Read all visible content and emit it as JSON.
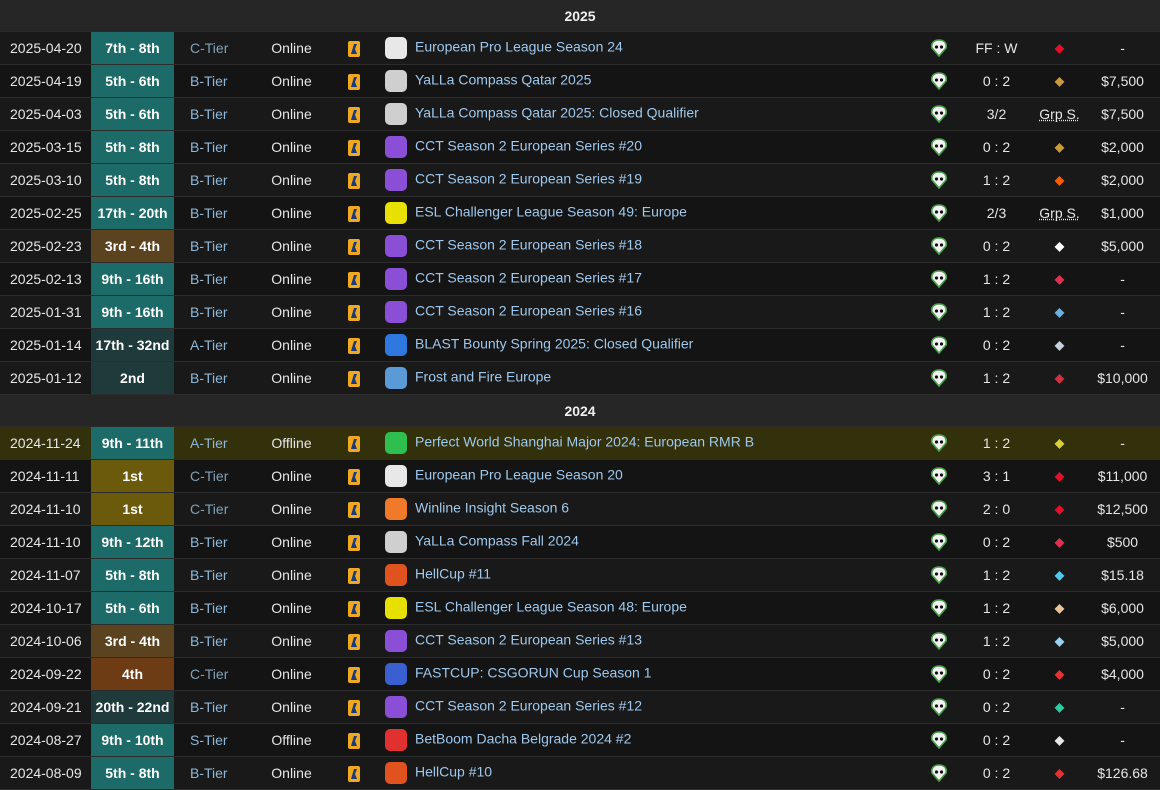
{
  "years": [
    {
      "label": "2025",
      "rows": [
        {
          "date": "2025-04-20",
          "place": "7th - 8th",
          "place_style": "teal",
          "tier": "C-Tier",
          "mode": "Online",
          "tournament": "European Pro League Season 24",
          "tournament_icon": "epl-logo-icon",
          "score": "FF : W",
          "opponent_icon": "dynamo-logo-icon",
          "prize": "-"
        },
        {
          "date": "2025-04-19",
          "place": "5th - 6th",
          "place_style": "teal",
          "tier": "B-Tier",
          "mode": "Online",
          "tournament": "YaLLa Compass Qatar 2025",
          "tournament_icon": "yalla-compass-logo-icon",
          "score": "0 : 2",
          "opponent_icon": "ence-logo-icon",
          "prize": "$7,500"
        },
        {
          "date": "2025-04-03",
          "place": "5th - 6th",
          "place_style": "teal",
          "tier": "B-Tier",
          "mode": "Online",
          "tournament": "YaLLa Compass Qatar 2025: Closed Qualifier",
          "tournament_icon": "yalla-compass-logo-icon",
          "score": "3/2",
          "opponent_text": "Grp S.",
          "prize": "$7,500"
        },
        {
          "date": "2025-03-15",
          "place": "5th - 8th",
          "place_style": "teal",
          "tier": "B-Tier",
          "mode": "Online",
          "tournament": "CCT Season 2 European Series #20",
          "tournament_icon": "cct-logo-icon",
          "score": "0 : 2",
          "opponent_icon": "ence-logo-icon",
          "prize": "$2,000"
        },
        {
          "date": "2025-03-10",
          "place": "5th - 8th",
          "place_style": "teal",
          "tier": "B-Tier",
          "mode": "Online",
          "tournament": "CCT Season 2 European Series #19",
          "tournament_icon": "cct-logo-icon",
          "score": "1 : 2",
          "opponent_icon": "fnatic-logo-icon",
          "prize": "$2,000"
        },
        {
          "date": "2025-02-25",
          "place": "17th - 20th",
          "place_style": "teal",
          "tier": "B-Tier",
          "mode": "Online",
          "tournament": "ESL Challenger League Season 49: Europe",
          "tournament_icon": "ecl-logo-icon",
          "score": "2/3",
          "opponent_text": "Grp S.",
          "prize": "$1,000"
        },
        {
          "date": "2025-02-23",
          "place": "3rd - 4th",
          "place_style": "bronze",
          "tier": "B-Tier",
          "mode": "Online",
          "tournament": "CCT Season 2 European Series #18",
          "tournament_icon": "cct-logo-icon",
          "score": "0 : 2",
          "opponent_icon": "betboom-logo-icon",
          "prize": "$5,000"
        },
        {
          "date": "2025-02-13",
          "place": "9th - 16th",
          "place_style": "teal",
          "tier": "B-Tier",
          "mode": "Online",
          "tournament": "CCT Season 2 European Series #17",
          "tournament_icon": "cct-logo-icon",
          "score": "1 : 2",
          "opponent_icon": "500-logo-icon",
          "prize": "-"
        },
        {
          "date": "2025-01-31",
          "place": "9th - 16th",
          "place_style": "teal",
          "tier": "B-Tier",
          "mode": "Online",
          "tournament": "CCT Season 2 European Series #16",
          "tournament_icon": "cct-logo-icon",
          "score": "1 : 2",
          "opponent_icon": "trident-logo-icon",
          "prize": "-"
        },
        {
          "date": "2025-01-14",
          "place": "17th - 32nd",
          "place_style": "dark",
          "tier": "A-Tier",
          "mode": "Online",
          "tournament": "BLAST Bounty Spring 2025: Closed Qualifier",
          "tournament_icon": "blast-logo-icon",
          "score": "0 : 2",
          "opponent_icon": "liquid-logo-icon",
          "prize": "-"
        },
        {
          "date": "2025-01-12",
          "place": "2nd",
          "place_style": "dark",
          "tier": "B-Tier",
          "mode": "Online",
          "tournament": "Frost and Fire Europe",
          "tournament_icon": "frost-fire-logo-icon",
          "score": "1 : 2",
          "opponent_icon": "red-wings-logo-icon",
          "prize": "$10,000"
        }
      ]
    },
    {
      "label": "2024",
      "rows": [
        {
          "date": "2024-11-24",
          "place": "9th - 11th",
          "place_style": "teal",
          "tier": "A-Tier",
          "mode": "Offline",
          "tournament": "Perfect World Shanghai Major 2024: European RMR B",
          "tournament_icon": "perfect-world-logo-icon",
          "score": "1 : 2",
          "opponent_icon": "ninjas-logo-icon",
          "prize": "-",
          "highlight": true
        },
        {
          "date": "2024-11-11",
          "place": "1st",
          "place_style": "gold",
          "tier": "C-Tier",
          "mode": "Online",
          "tournament": "European Pro League Season 20",
          "tournament_icon": "epl-logo-icon",
          "score": "3 : 1",
          "opponent_icon": "dynamo-logo-icon",
          "prize": "$11,000"
        },
        {
          "date": "2024-11-10",
          "place": "1st",
          "place_style": "gold",
          "tier": "C-Tier",
          "mode": "Online",
          "tournament": "Winline Insight Season 6",
          "tournament_icon": "winline-logo-icon",
          "score": "2 : 0",
          "opponent_icon": "dynamo-logo-icon",
          "prize": "$12,500"
        },
        {
          "date": "2024-11-10",
          "place": "9th - 12th",
          "place_style": "teal",
          "tier": "B-Tier",
          "mode": "Online",
          "tournament": "YaLLa Compass Fall 2024",
          "tournament_icon": "yalla-compass-logo-icon",
          "score": "0 : 2",
          "opponent_icon": "500-logo-icon",
          "prize": "$500"
        },
        {
          "date": "2024-11-07",
          "place": "5th - 8th",
          "place_style": "teal",
          "tier": "B-Tier",
          "mode": "Online",
          "tournament": "HellCup #11",
          "tournament_icon": "hellcup-logo-icon",
          "score": "1 : 2",
          "opponent_icon": "aurora-logo-icon",
          "prize": "$15.18"
        },
        {
          "date": "2024-10-17",
          "place": "5th - 6th",
          "place_style": "teal",
          "tier": "B-Tier",
          "mode": "Online",
          "tournament": "ESL Challenger League Season 48: Europe",
          "tournament_icon": "ecl-logo-icon",
          "score": "1 : 2",
          "opponent_icon": "apeks-logo-icon",
          "prize": "$6,000"
        },
        {
          "date": "2024-10-06",
          "place": "3rd - 4th",
          "place_style": "bronze",
          "tier": "B-Tier",
          "mode": "Online",
          "tournament": "CCT Season 2 European Series #13",
          "tournament_icon": "cct-logo-icon",
          "score": "1 : 2",
          "opponent_icon": "gl-logo-icon",
          "prize": "$5,000"
        },
        {
          "date": "2024-09-22",
          "place": "4th",
          "place_style": "orange",
          "tier": "C-Tier",
          "mode": "Online",
          "tournament": "FASTCUP: CSGORUN Cup Season 1",
          "tournament_icon": "csgorun-logo-icon",
          "score": "0 : 2",
          "opponent_icon": "navi-logo-icon",
          "prize": "$4,000"
        },
        {
          "date": "2024-09-21",
          "place": "20th - 22nd",
          "place_style": "dark",
          "tier": "B-Tier",
          "mode": "Online",
          "tournament": "CCT Season 2 European Series #12",
          "tournament_icon": "cct-logo-icon",
          "score": "0 : 2",
          "opponent_icon": "monte-logo-icon",
          "prize": "-"
        },
        {
          "date": "2024-08-27",
          "place": "9th - 10th",
          "place_style": "teal",
          "tier": "S-Tier",
          "mode": "Offline",
          "tournament": "BetBoom Dacha Belgrade 2024 #2",
          "tournament_icon": "betboom-dacha-logo-icon",
          "score": "0 : 2",
          "opponent_icon": "furia-logo-icon",
          "prize": "-"
        },
        {
          "date": "2024-08-09",
          "place": "5th - 8th",
          "place_style": "teal",
          "tier": "B-Tier",
          "mode": "Online",
          "tournament": "HellCup #10",
          "tournament_icon": "hellcup-logo-icon",
          "score": "0 : 2",
          "opponent_icon": "navi-logo-icon",
          "prize": "$126.68"
        }
      ]
    }
  ],
  "game_icon": "counter-strike-icon",
  "team_icon": "team-alien-logo-icon",
  "colors": {
    "accent_link": "#9fc8ec",
    "teal": "#1d6b68",
    "bronze": "#5c4320",
    "gold": "#6b5a0c",
    "orange": "#6e3c14",
    "highlight_row": "#33300c"
  }
}
